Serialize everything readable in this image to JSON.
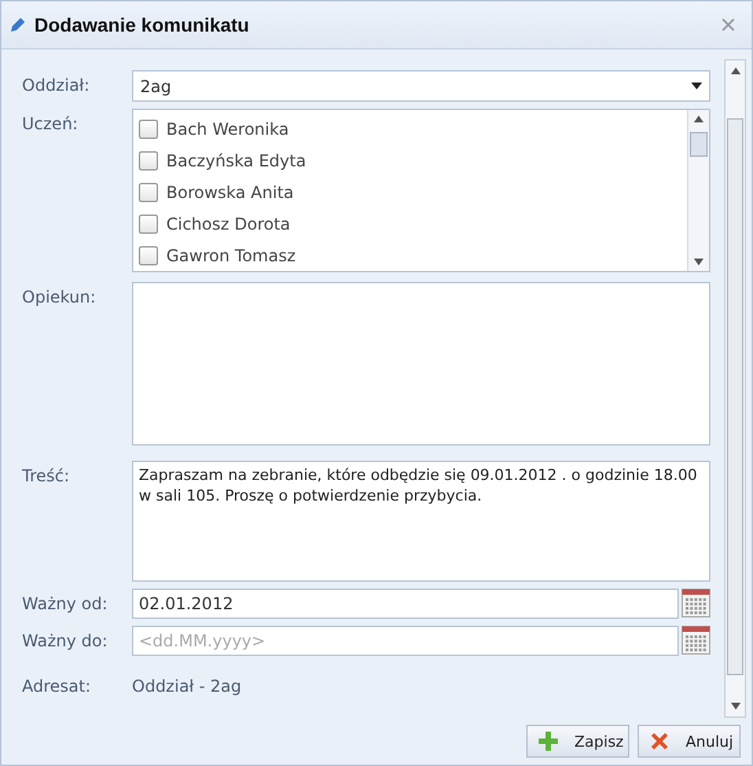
{
  "window": {
    "title": "Dodawanie komunikatu"
  },
  "form": {
    "class_label": "Oddział:",
    "class_value": "2ag",
    "student_label": "Uczeń:",
    "students": [
      {
        "name": "Bach Weronika",
        "checked": false
      },
      {
        "name": "Baczyńska Edyta",
        "checked": false
      },
      {
        "name": "Borowska Anita",
        "checked": false
      },
      {
        "name": "Cichosz Dorota",
        "checked": false
      },
      {
        "name": "Gawron Tomasz",
        "checked": false
      }
    ],
    "guardian_label": "Opiekun:",
    "content_label": "Treść:",
    "content": "Zapraszam na zebranie, które odbędzie się 09.01.2012 . o godzinie 18.00 w sali 105. Proszę o potwierdzenie przybycia.",
    "valid_from_label": "Ważny od:",
    "valid_from": "02.01.2012",
    "valid_to_label": "Ważny do:",
    "valid_to_placeholder": "<dd.MM.yyyy>",
    "recipient_label": "Adresat:",
    "recipient": "Oddział - 2ag"
  },
  "buttons": [
    {
      "label": "Zapisz",
      "kind": "save"
    },
    {
      "label": "Anuluj",
      "kind": "cancel"
    }
  ]
}
